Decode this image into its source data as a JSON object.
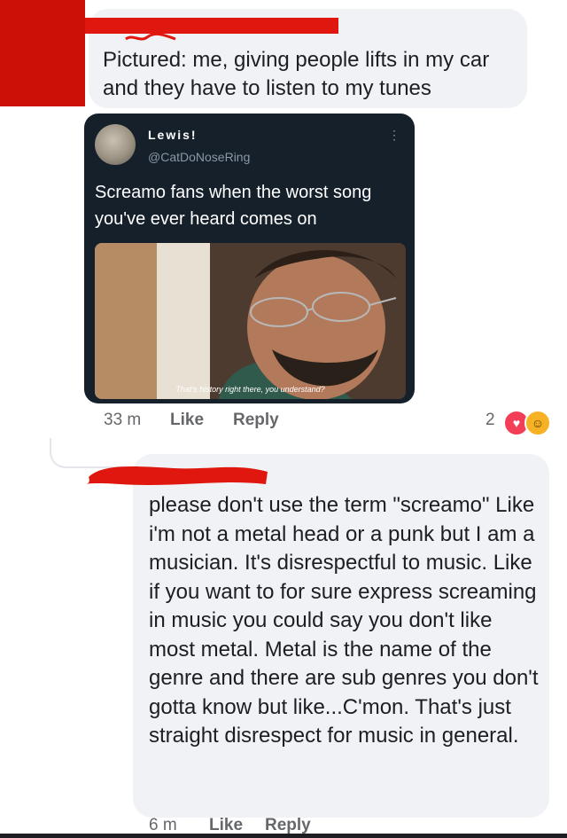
{
  "post": {
    "comment_text": "Pictured: me, giving people lifts in my car and they have to listen to my tunes",
    "tweet": {
      "name": "Lewis!",
      "handle": "@CatDoNoseRing",
      "more_icon": "⋮",
      "text": "Screamo fans when the worst song you've ever heard comes on",
      "image_caption": "That's history right there, you understand?"
    },
    "meta": {
      "time": "33 m",
      "like_label": "Like",
      "reply_label": "Reply",
      "reaction_count": "2"
    },
    "reactions": {
      "heart_icon": "♥",
      "haha_icon": "☺"
    }
  },
  "reply": {
    "comment_text": "please don't use the term \"screamo\" Like i'm not a metal head or a punk but I am a musician. It's disrespectful to music. Like if you want to for sure express screaming in music you could say you don't like most metal. Metal is the name of the genre and there are sub genres you don't gotta know but like...C'mon. That's just straight disrespect for music in general.",
    "meta": {
      "time": "6 m",
      "like_label": "Like",
      "reply_label": "Reply"
    }
  },
  "colors": {
    "bubble": "#f0f2f5",
    "tweet_bg": "#15202b",
    "redaction": "#e0170f",
    "meta_text": "#65676b",
    "heart": "#f33e58",
    "haha": "#f7b125"
  }
}
